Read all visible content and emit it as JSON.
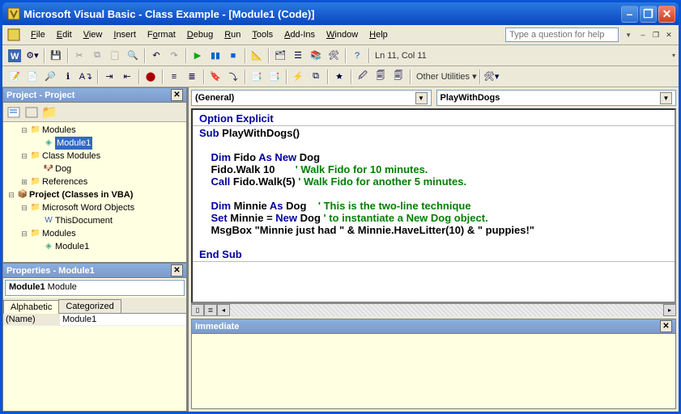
{
  "window": {
    "title": "Microsoft Visual Basic - Class Example - [Module1 (Code)]"
  },
  "menu": {
    "file": "File",
    "edit": "Edit",
    "view": "View",
    "insert": "Insert",
    "format": "Format",
    "debug": "Debug",
    "run": "Run",
    "tools": "Tools",
    "addins": "Add-Ins",
    "window": "Window",
    "help": "Help",
    "help_placeholder": "Type a question for help"
  },
  "status": {
    "cursor": "Ln 11, Col 11"
  },
  "toolbar2": {
    "other_utilities": "Other Utilities "
  },
  "project_panel": {
    "title": "Project - Project",
    "tree": {
      "modules": "Modules",
      "module1": "Module1",
      "class_modules": "Class Modules",
      "dog": "Dog",
      "references": "References",
      "project_vba": "Project (Classes in VBA)",
      "word_objects": "Microsoft Word Objects",
      "thisdoc": "ThisDocument",
      "modules2": "Modules",
      "module1b": "Module1"
    }
  },
  "properties_panel": {
    "title": "Properties - Module1",
    "obj_name": "Module1",
    "obj_type": " Module",
    "tab_alpha": "Alphabetic",
    "tab_cat": "Categorized",
    "row_name_label": "(Name)",
    "row_name_value": "Module1"
  },
  "code": {
    "left_combo": "(General)",
    "right_combo": "PlayWithDogs",
    "lines": [
      {
        "t": "kw",
        "s": "Option Explicit"
      },
      {
        "t": "hr"
      },
      {
        "t": "mix",
        "parts": [
          [
            "kw",
            "Sub "
          ],
          [
            "tx",
            "PlayWithDogs()"
          ]
        ]
      },
      {
        "t": "blank"
      },
      {
        "t": "mix",
        "parts": [
          [
            "tx",
            "    "
          ],
          [
            "kw",
            "Dim "
          ],
          [
            "tx",
            "Fido "
          ],
          [
            "kw",
            "As New "
          ],
          [
            "tx",
            "Dog"
          ]
        ]
      },
      {
        "t": "mix",
        "parts": [
          [
            "tx",
            "    Fido.Walk 10       "
          ],
          [
            "cm",
            "' Walk Fido for 10 minutes."
          ]
        ]
      },
      {
        "t": "mix",
        "parts": [
          [
            "tx",
            "    "
          ],
          [
            "kw",
            "Call "
          ],
          [
            "tx",
            "Fido.Walk(5) "
          ],
          [
            "cm",
            "' Walk Fido for another 5 minutes."
          ]
        ]
      },
      {
        "t": "blank"
      },
      {
        "t": "mix",
        "parts": [
          [
            "tx",
            "    "
          ],
          [
            "kw",
            "Dim "
          ],
          [
            "tx",
            "Minnie "
          ],
          [
            "kw",
            "As "
          ],
          [
            "tx",
            "Dog    "
          ],
          [
            "cm",
            "' This is the two-line technique"
          ]
        ]
      },
      {
        "t": "mix",
        "parts": [
          [
            "tx",
            "    "
          ],
          [
            "kw",
            "Set "
          ],
          [
            "tx",
            "Minnie = "
          ],
          [
            "kw",
            "New "
          ],
          [
            "tx",
            "Dog "
          ],
          [
            "cm",
            "' to instantiate a New Dog object."
          ]
        ]
      },
      {
        "t": "mix",
        "parts": [
          [
            "tx",
            "    MsgBox \"Minnie just had \" & Minnie.HaveLitter(10) & \" puppies!\""
          ]
        ]
      },
      {
        "t": "blank"
      },
      {
        "t": "kw",
        "s": "End Sub"
      },
      {
        "t": "hr"
      }
    ]
  },
  "immediate": {
    "title": "Immediate"
  },
  "chart_data": null
}
